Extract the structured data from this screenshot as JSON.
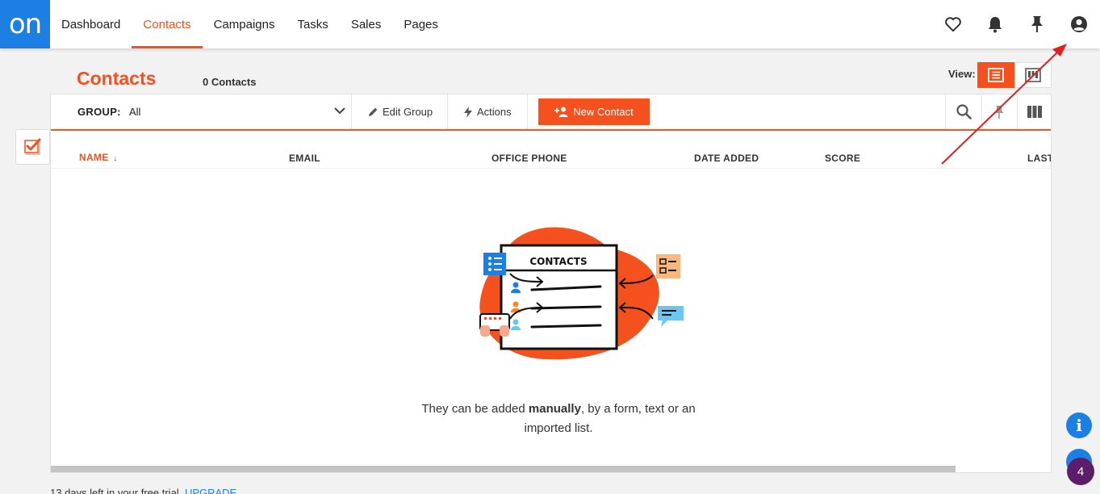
{
  "app": {
    "logo_text": "on"
  },
  "nav": {
    "items": [
      {
        "label": "Dashboard"
      },
      {
        "label": "Contacts",
        "active": true
      },
      {
        "label": "Campaigns"
      },
      {
        "label": "Tasks"
      },
      {
        "label": "Sales"
      },
      {
        "label": "Pages"
      }
    ]
  },
  "top_icons": [
    "heart-icon",
    "bell-icon",
    "pin-icon",
    "account-icon"
  ],
  "header": {
    "title": "Contacts",
    "count": "0 Contacts",
    "view_label": "View:"
  },
  "toolbar": {
    "group_label": "GROUP:",
    "group_value": "All",
    "edit_group": "Edit Group",
    "actions": "Actions",
    "new_contact": "New Contact"
  },
  "table": {
    "columns": [
      "NAME",
      "EMAIL",
      "OFFICE PHONE",
      "DATE ADDED",
      "SCORE",
      "LAST"
    ],
    "sort_indicator": "↓"
  },
  "empty_state": {
    "illustration_title": "CONTACTS",
    "text_before": "They can be added ",
    "text_bold": "manually",
    "text_after": ", by a form, text or an imported list."
  },
  "trial": {
    "text": "13 days left in your free trial.",
    "link": "UPGRADE"
  },
  "widgets": {
    "info_label": "i",
    "badge_count": "4"
  },
  "colors": {
    "accent": "#f4511e",
    "brand_blue": "#1c7fe3",
    "badge_purple": "#5c1e6b",
    "annotation_arrow": "#e02020"
  }
}
